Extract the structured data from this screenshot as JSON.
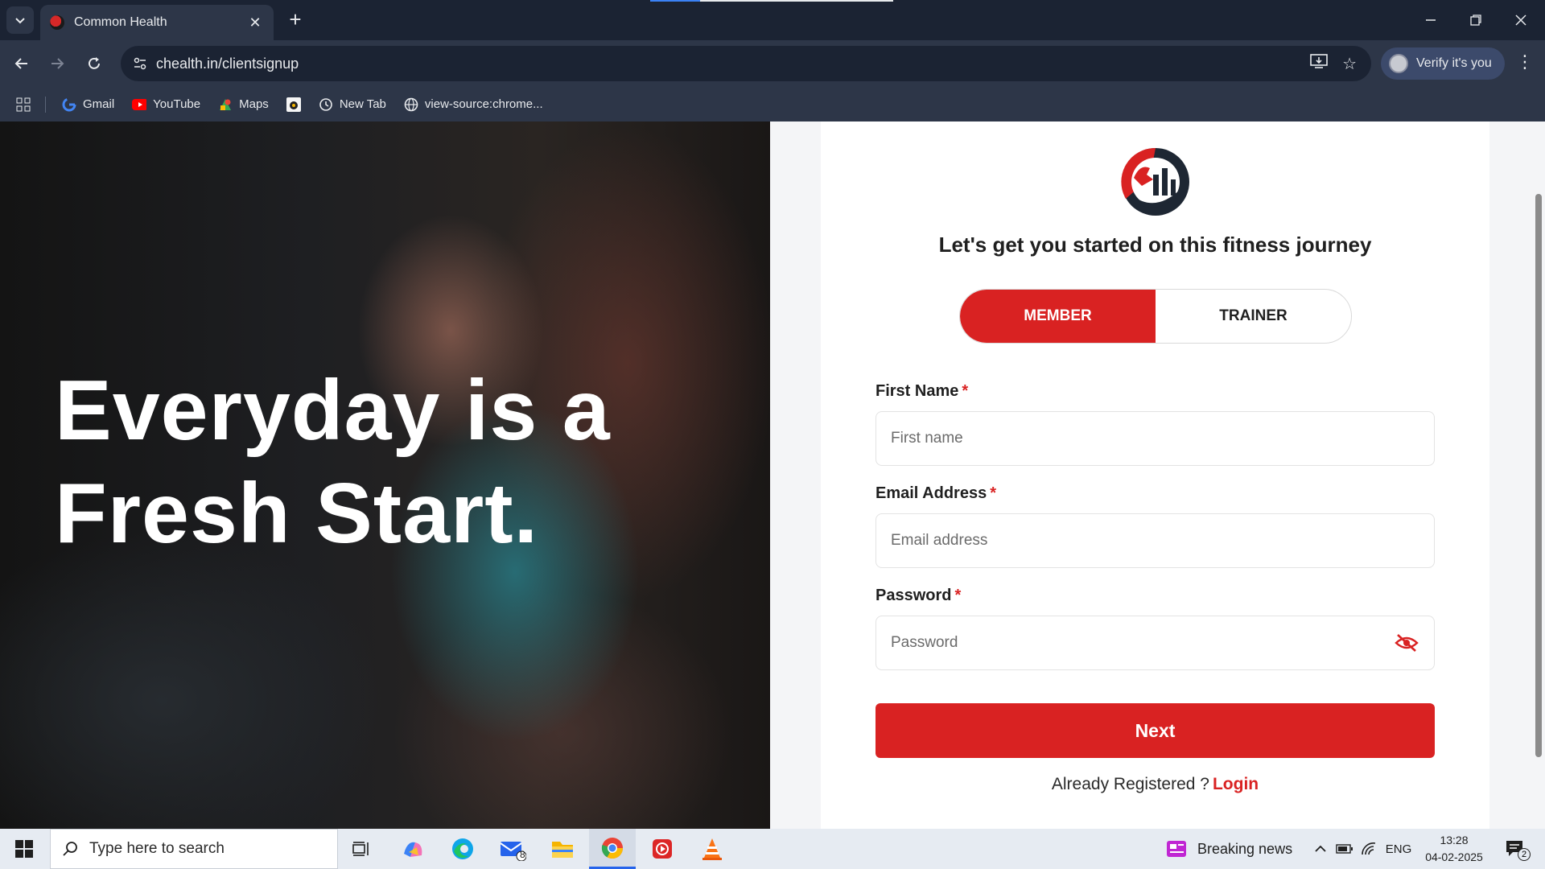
{
  "browser": {
    "tab_title": "Common Health",
    "url": "chealth.in/clientsignup",
    "verify_label": "Verify it's you",
    "bookmarks": [
      {
        "label": "Gmail",
        "icon": "google-icon"
      },
      {
        "label": "YouTube",
        "icon": "youtube-icon"
      },
      {
        "label": "Maps",
        "icon": "maps-icon"
      },
      {
        "label": "",
        "icon": "bookmark-app-icon"
      },
      {
        "label": "New Tab",
        "icon": "history-icon"
      },
      {
        "label": "view-source:chrome...",
        "icon": "globe-icon"
      }
    ]
  },
  "hero": {
    "line1": "Everyday is a",
    "line2": "Fresh Start."
  },
  "signup": {
    "heading": "Let's get you started on this fitness journey",
    "toggle": {
      "member": "MEMBER",
      "trainer": "TRAINER",
      "selected": "MEMBER"
    },
    "fields": {
      "first_name": {
        "label": "First Name",
        "required": "*",
        "placeholder": "First name",
        "value": ""
      },
      "email": {
        "label": "Email Address",
        "required": "*",
        "placeholder": "Email address",
        "value": ""
      },
      "password": {
        "label": "Password",
        "required": "*",
        "placeholder": "Password",
        "value": ""
      }
    },
    "next_label": "Next",
    "already_text": "Already Registered ?",
    "login_label": "Login",
    "accent_color": "#d92222"
  },
  "taskbar": {
    "search_placeholder": "Type here to search",
    "mail_badge": "8",
    "news_label": "Breaking news",
    "language": "ENG",
    "time": "13:28",
    "date": "04-02-2025",
    "notification_count": "2"
  }
}
